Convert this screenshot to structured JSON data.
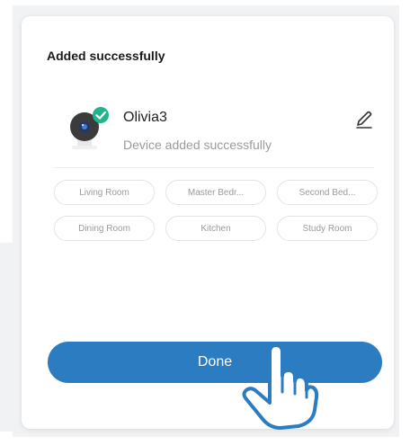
{
  "dialog": {
    "title": "Added successfully"
  },
  "device": {
    "name": "Olivia3",
    "status": "Device added successfully",
    "icon": "camera-icon",
    "badge_icon": "check-badge-icon"
  },
  "rooms": [
    {
      "label": "Living Room"
    },
    {
      "label": "Master Bedr..."
    },
    {
      "label": "Second Bed..."
    },
    {
      "label": "Dining Room"
    },
    {
      "label": "Kitchen"
    },
    {
      "label": "Study Room"
    }
  ],
  "actions": {
    "done_label": "Done"
  },
  "colors": {
    "accent": "#2c7cc2",
    "success": "#1fb58a",
    "muted_text": "#9a9a9a"
  }
}
